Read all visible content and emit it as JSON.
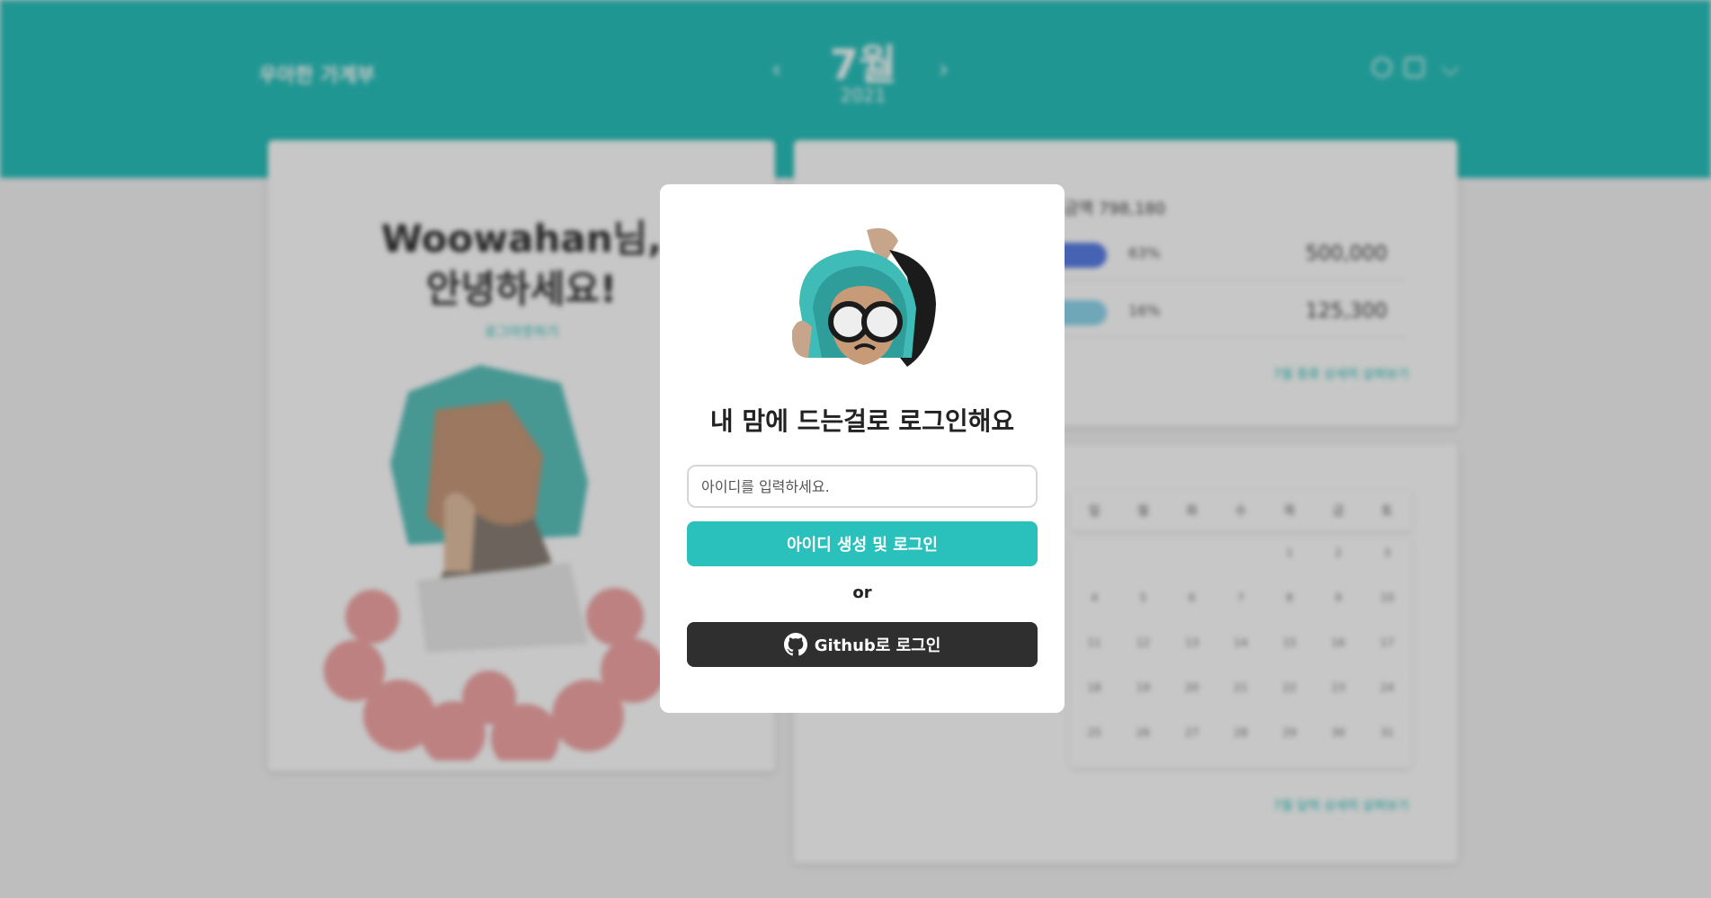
{
  "app": {
    "brand": "우아한 가계부",
    "month": "7월",
    "year": "2021",
    "prev_arrow": "‹",
    "next_arrow": "›"
  },
  "greeting": {
    "line1": "Woowahan님,",
    "line2": "안녕하세요!",
    "logout": "로그아웃하기"
  },
  "summary": {
    "total_label": "금액",
    "total_value": "798,180",
    "rows": [
      {
        "percent": "63%",
        "amount": "500,000",
        "color": "#5a7ee6"
      },
      {
        "percent": "16%",
        "amount": "125,300",
        "color": "#8fd6ee"
      }
    ],
    "more_link": "7월 종류 상세히 살펴보기"
  },
  "calendar": {
    "weekdays": [
      "일",
      "월",
      "화",
      "수",
      "목",
      "금",
      "토"
    ],
    "days": [
      "",
      "",
      "",
      "",
      "1",
      "2",
      "3",
      "4",
      "5",
      "6",
      "7",
      "8",
      "9",
      "10",
      "11",
      "12",
      "13",
      "14",
      "15",
      "16",
      "17",
      "18",
      "19",
      "20",
      "21",
      "22",
      "23",
      "24",
      "25",
      "26",
      "27",
      "28",
      "29",
      "30",
      "31"
    ],
    "more_link": "7월 달력 상세히 살펴보기"
  },
  "modal": {
    "title": "내 맘에 드는걸로 로그인해요",
    "id_placeholder": "아이디를 입력하세요.",
    "create_button": "아이디 생성 및 로그인",
    "or_text": "or",
    "github_button": "Github로 로그인",
    "accent_color": "#2ac1bc",
    "github_color": "#2f2f2f"
  }
}
